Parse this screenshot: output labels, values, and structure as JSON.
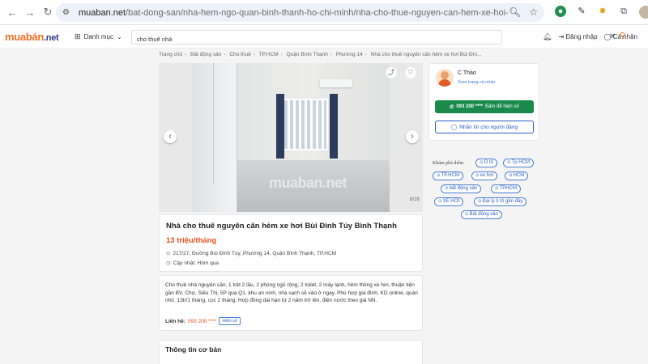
{
  "browser": {
    "url_domain": "muaban.net",
    "url_path": "/bat-dong-san/nha-hem-ngo-quan-binh-thanh-ho-chi-minh/nha-cho-thue-nguyen-can-hem-xe-hoi-217-27-bui-dinh..."
  },
  "header": {
    "logo_main": "muabán",
    "logo_suffix": ".net",
    "category_label": "Danh mục",
    "search_value": "cho thuê nhà",
    "login_label": "Đăng nhập",
    "account_label": "Cá nhân"
  },
  "breadcrumb": [
    "Trang chủ",
    "Bất động sản",
    "Cho thuê",
    "TP.HCM",
    "Quận Bình Thạnh",
    "Phường 14",
    "Nhà cho thuê nguyên căn hẻm xe hơi Bùi Đìn..."
  ],
  "gallery": {
    "watermark": "muaban.net",
    "count": "8/16"
  },
  "listing": {
    "title": "Nhà cho thuê nguyên căn hẻm xe hơi Bùi Đình Túy Bình Thạnh",
    "price": "13 triệu/tháng",
    "address": "217/27, Đường Bùi Đình Túy, Phường 14, Quận Bình Thạnh, TP.HCM",
    "updated": "Cập nhật: Hôm qua"
  },
  "description": {
    "text": "Cho thuê nhà nguyên căn, 1 trệt 2 lầu, 2 phòng ngủ rộng, 2 toilet, 2 máy lạnh, hẻm thông xe hơi, thuận tiện gần BV, Chợ, Siêu Thị, 5P qua Q1, khu an ninh, nhà sạch sẽ vào ở ngay. Phù hợp gia đình, KD online, quán nhỏ. 13tr/1 tháng, cọc 2 tháng. Hợp đồng dài hạn từ 2 năm trở lên, điện nước theo giá NN.",
    "contact_label": "Liên hệ:",
    "contact_phone": "093 200 ****",
    "show_label": "Hiện số"
  },
  "basic_info": {
    "title": "Thông tin cơ bản"
  },
  "seller": {
    "name": "C Thảo",
    "profile_link": "Xem trang cá nhân",
    "phone": "093 200 ****",
    "reveal_label": "Bấm để hiện số",
    "chat_label": "Nhắn tin cho người đăng"
  },
  "explore": {
    "label": "Khám phá thêm",
    "tags": [
      "Ô tô",
      "Tp HCM",
      "TP.HCM",
      "xe hơi",
      "HCM",
      "bất động sản",
      "TPHCM",
      "XE HƠI",
      "Đại lý ô tô gần đây",
      "Bất động sản"
    ]
  },
  "colors": {
    "brand_orange": "#f36f21",
    "call_green": "#1a8a4a",
    "link_blue": "#2a5fc0",
    "price_red": "#e8501e"
  }
}
